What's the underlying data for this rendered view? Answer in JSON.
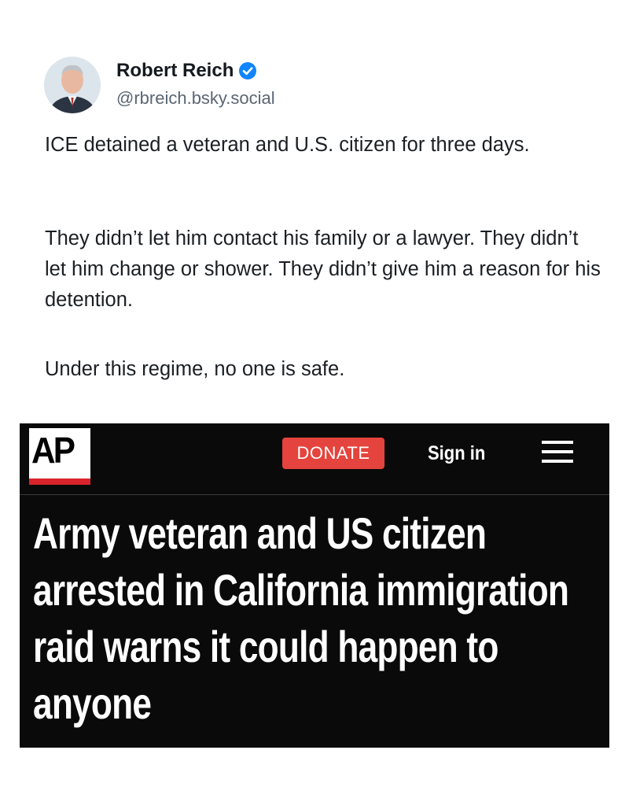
{
  "post": {
    "author_name": "Robert Reich",
    "author_handle": "@rbreich.bsky.social",
    "verified_icon": "verified-check-icon",
    "paragraphs": [
      "ICE detained a veteran and U.S. citizen for three days.",
      "They didn’t let him contact his family or a lawyer. They didn’t let him change or shower. They didn’t give him a reason for his detention.",
      "Under this regime, no one is safe."
    ],
    "colors": {
      "verified": "#1185fe",
      "text": "#1b1f23",
      "handle": "#5a6672"
    }
  },
  "ap": {
    "logo_text": "AP",
    "donate_label": "DONATE",
    "signin_label": "Sign in",
    "menu_icon": "hamburger-menu-icon",
    "headline": "Army veteran and US citizen arrested in California immigration raid warns it could happen to anyone",
    "colors": {
      "background": "#0a0a0a",
      "donate": "#e5433d",
      "logo_bar": "#d9242b"
    }
  }
}
